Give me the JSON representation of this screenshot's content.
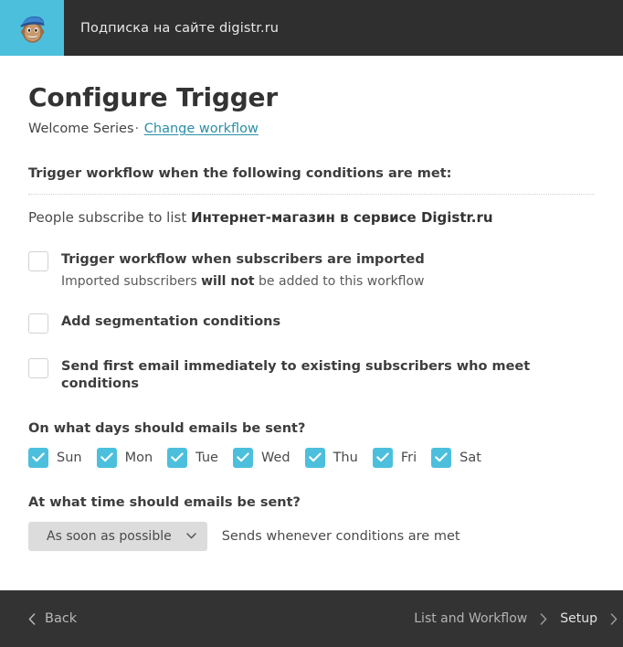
{
  "header": {
    "logo_icon": "mailchimp-freddie-icon",
    "title": "Подписка на сайте digistr.ru",
    "background_color": "#2f2f2f",
    "logo_background_color": "#4cbfdd"
  },
  "page": {
    "title": "Configure Trigger",
    "workflow_name": "Welcome Series",
    "separator": "·",
    "change_link": "Change workflow",
    "link_color": "#2b8fa6"
  },
  "trigger": {
    "section_heading": "Trigger workflow when the following conditions are met:",
    "condition_prefix": "People subscribe to list ",
    "condition_list_name": "Интернет-магазин в сервисе Digistr.ru"
  },
  "options": [
    {
      "label": "Trigger workflow when subscribers are imported",
      "checked": false,
      "sub_prefix": "Imported subscribers ",
      "sub_bold": "will not",
      "sub_suffix": " be added to this workflow"
    },
    {
      "label": "Add segmentation conditions",
      "checked": false
    },
    {
      "label": "Send first email immediately to existing subscribers who meet conditions",
      "checked": false
    }
  ],
  "days": {
    "heading": "On what days should emails be sent?",
    "checked_color": "#4cbfdd",
    "items": [
      {
        "label": "Sun",
        "checked": true
      },
      {
        "label": "Mon",
        "checked": true
      },
      {
        "label": "Tue",
        "checked": true
      },
      {
        "label": "Wed",
        "checked": true
      },
      {
        "label": "Thu",
        "checked": true
      },
      {
        "label": "Fri",
        "checked": true
      },
      {
        "label": "Sat",
        "checked": true
      }
    ]
  },
  "time": {
    "heading": "At what time should emails be sent?",
    "selected": "As soon as possible",
    "dropdown_icon": "chevron-down-icon",
    "hint": "Sends whenever conditions are met"
  },
  "footer": {
    "background_color": "#333333",
    "back_icon": "chevron-left-icon",
    "back_label": "Back",
    "breadcrumbs": [
      {
        "label": "List and Workflow",
        "active": false
      },
      {
        "label": "Setup",
        "active": true
      }
    ],
    "separator_icon": "chevron-right-icon"
  }
}
